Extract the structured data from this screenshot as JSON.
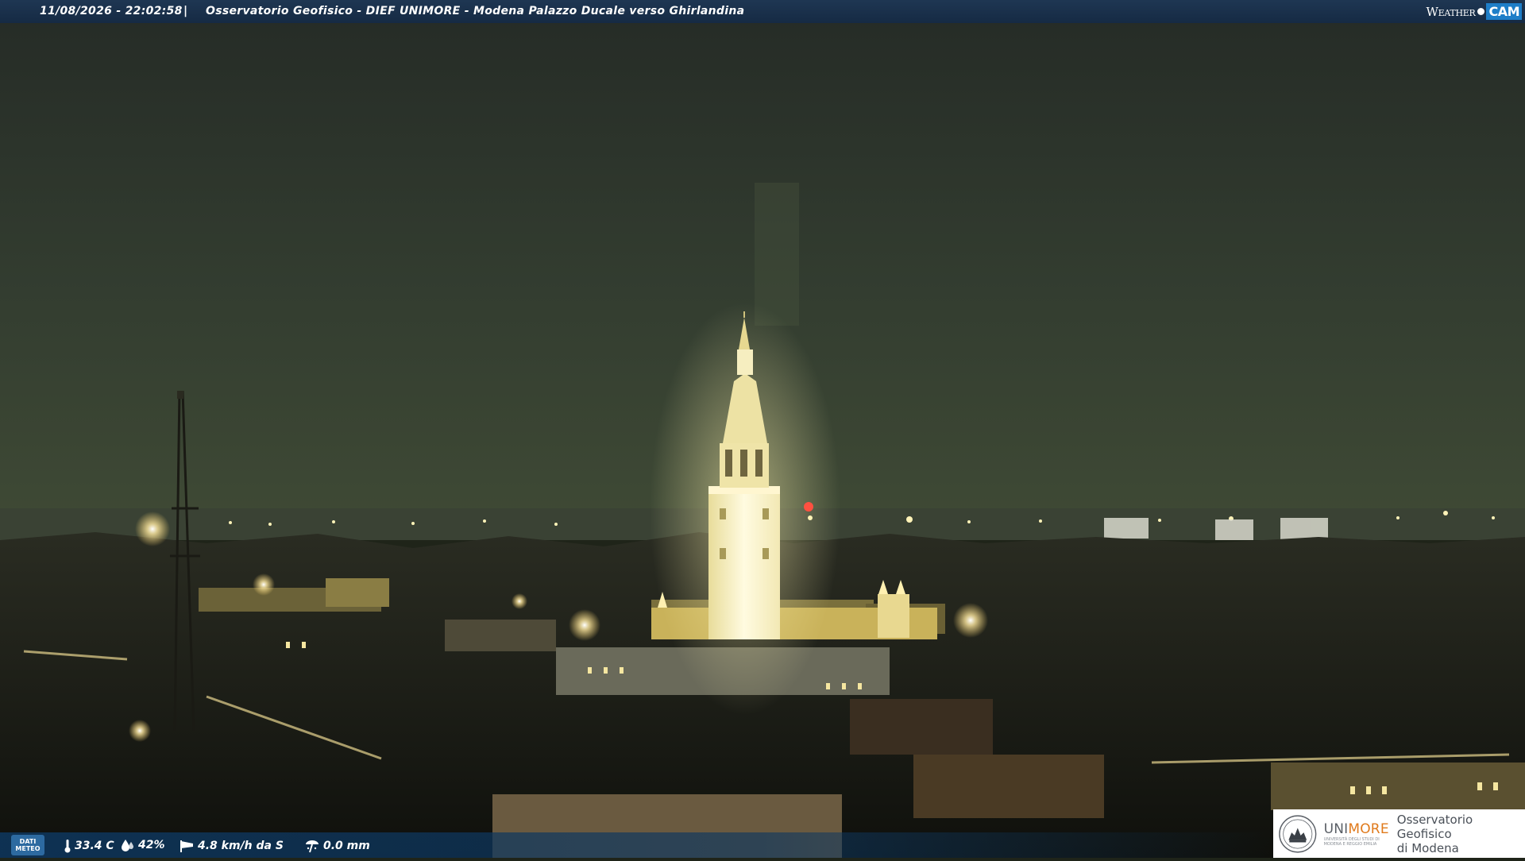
{
  "topbar": {
    "timestamp": "11/08/2026 - 22:02:58",
    "separator": "|",
    "title": "Osservatorio Geofisico - DIEF UNIMORE - Modena Palazzo Ducale verso Ghirlandina",
    "logo_weather": "Weather",
    "logo_cam": "CAM",
    "logo_cam_color": "#1e7ec8"
  },
  "bottombar": {
    "badge_line1": "DATI",
    "badge_line2": "METEO",
    "temperature": "33.4 C",
    "humidity": "42%",
    "wind": "4.8 km/h da S",
    "rain": "0.0 mm",
    "icons": [
      "thermometer-icon",
      "humidity-drop-icon",
      "wind-sock-icon",
      "rain-gauge-icon"
    ]
  },
  "institution": {
    "name_prefix": "UNI",
    "name_suffix": "MORE",
    "subtitle_line1": "UNIVERSITÀ DEGLI STUDI DI",
    "subtitle_line2": "MODENA E REGGIO EMILIA",
    "observatory_line1": "Osservatorio Geofisico",
    "observatory_line2": "di Modena",
    "accent_color": "#e07a1c"
  },
  "colors": {
    "sky_top": "#262d26",
    "sky_horizon": "#3b4633",
    "tower_lit": "#fff6c8",
    "city_dark": "#14140f",
    "street_light": "#ffd870"
  }
}
